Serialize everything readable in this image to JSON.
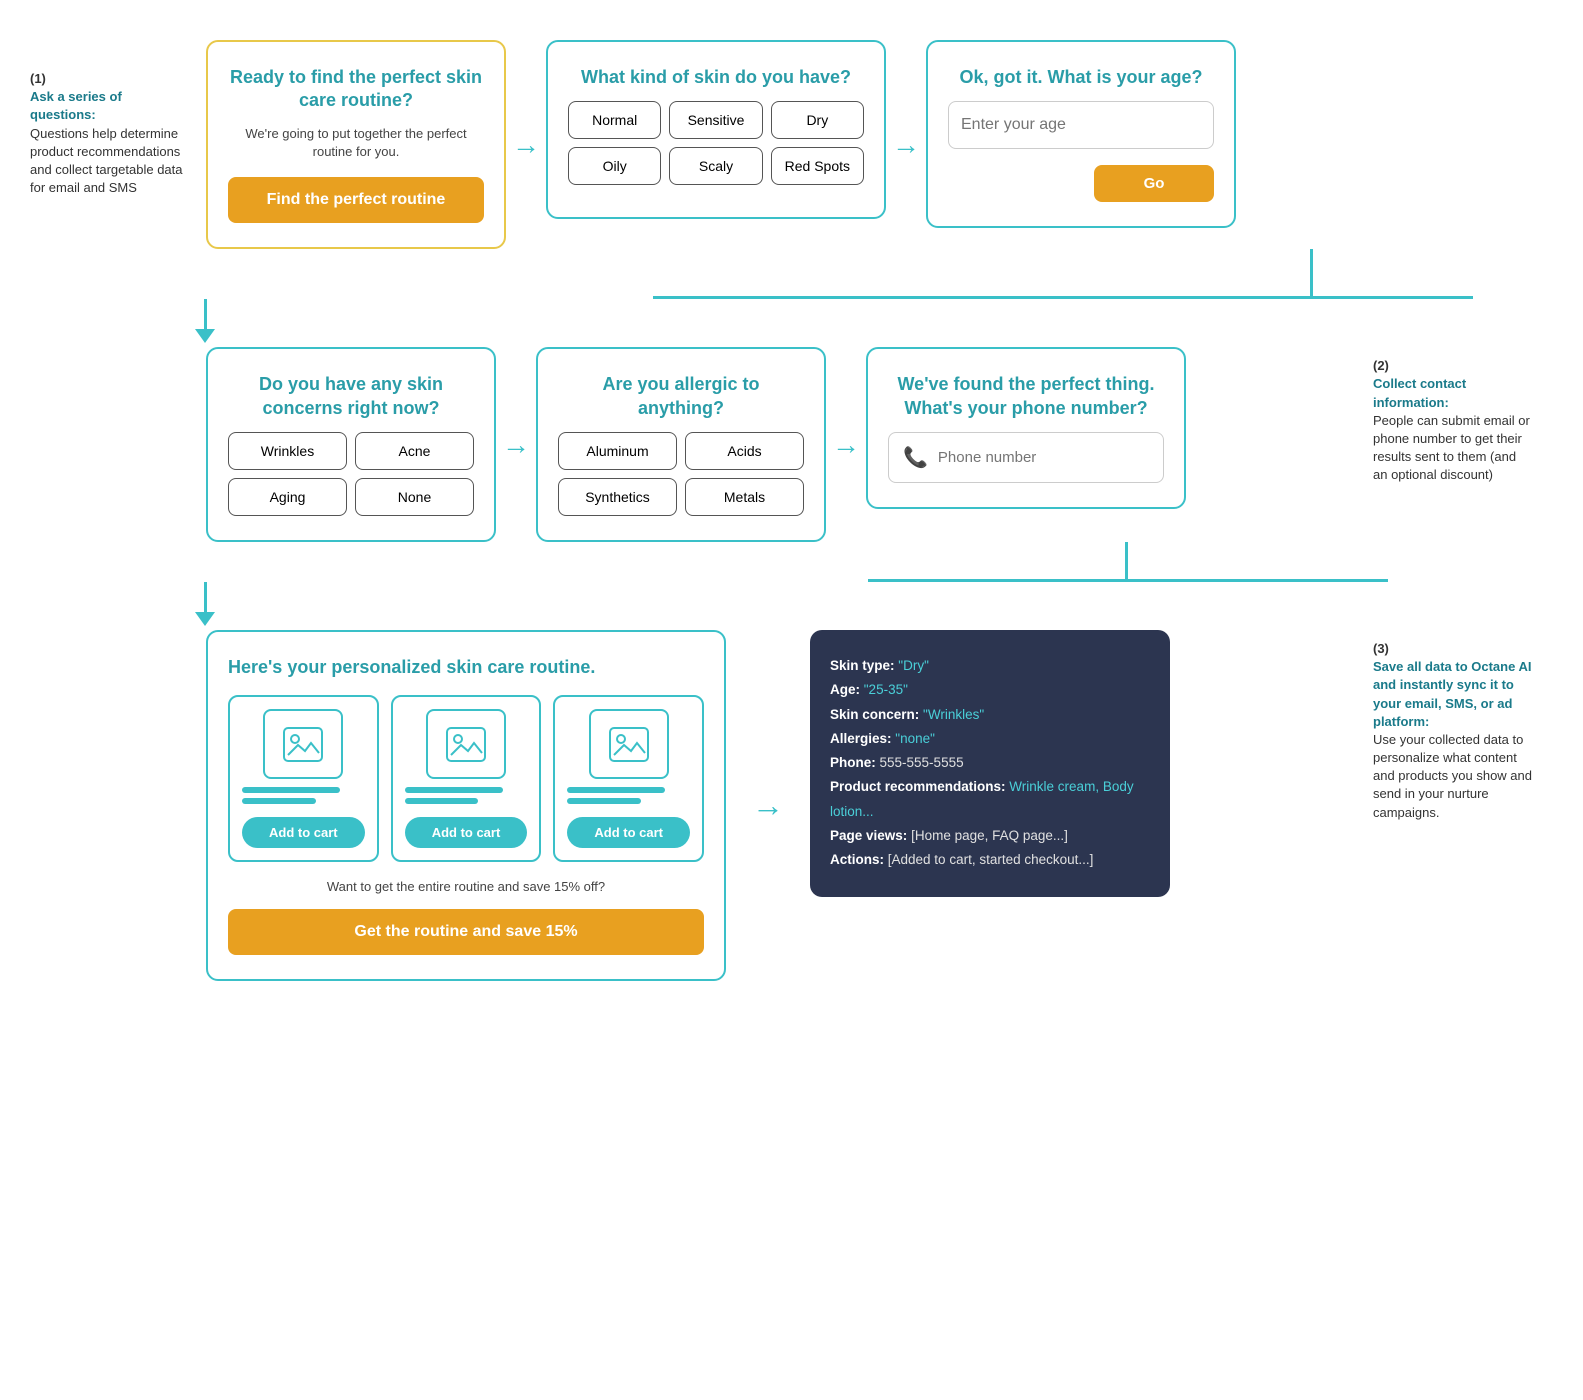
{
  "sidebar_note_1": {
    "num": "(1)",
    "title": "Ask a series of questions:",
    "text": "Questions help determine product recommendations and collect targetable data for email and SMS"
  },
  "sidebar_note_2": {
    "num": "(2)",
    "title": "Collect contact information:",
    "text": "People can submit email or phone number to get their results sent to them (and an optional discount)"
  },
  "sidebar_note_3": {
    "num": "(3)",
    "title": "Save all data to Octane AI and instantly sync it to your email, SMS, or ad platform:",
    "text": "Use your collected data to personalize what content and products you show and send in your nurture campaigns."
  },
  "card_intro": {
    "heading": "Ready to find the perfect skin care routine?",
    "body": "We're going to put together the perfect routine for you.",
    "button": "Find the perfect routine"
  },
  "card_skin": {
    "heading": "What kind of skin do you have?",
    "options": [
      "Normal",
      "Sensitive",
      "Dry",
      "Oily",
      "Scaly",
      "Red Spots"
    ]
  },
  "card_age": {
    "heading": "Ok, got it. What is your age?",
    "placeholder": "Enter your age",
    "button": "Go"
  },
  "card_concerns": {
    "heading": "Do you have any skin concerns right now?",
    "options": [
      "Wrinkles",
      "Acne",
      "Aging",
      "None"
    ]
  },
  "card_allergies": {
    "heading": "Are you allergic to anything?",
    "options": [
      "Aluminum",
      "Acids",
      "Synthetics",
      "Metals"
    ]
  },
  "card_phone": {
    "heading": "We've found the perfect thing. What's your phone number?",
    "placeholder": "Phone number"
  },
  "card_results": {
    "heading": "Here's your personalized skin care routine.",
    "add_to_cart": "Add to cart",
    "save_text": "Want to get the entire routine and save 15% off?",
    "save_button": "Get the routine and save 15%"
  },
  "card_data": {
    "skin_type_label": "Skin type:",
    "skin_type_val": "\"Dry\"",
    "age_label": "Age:",
    "age_val": "\"25-35\"",
    "skin_concern_label": "Skin concern:",
    "skin_concern_val": "\"Wrinkles\"",
    "allergies_label": "Allergies:",
    "allergies_val": "\"none\"",
    "phone_label": "Phone:",
    "phone_val": "555-555-5555",
    "product_rec_label": "Product recommendations:",
    "product_rec_val": "Wrinkle cream, Body lotion...",
    "page_views_label": "Page views:",
    "page_views_val": "[Home page, FAQ page...]",
    "actions_label": "Actions:",
    "actions_val": "[Added to cart, started checkout...]"
  },
  "arrows": {
    "right": "→"
  }
}
